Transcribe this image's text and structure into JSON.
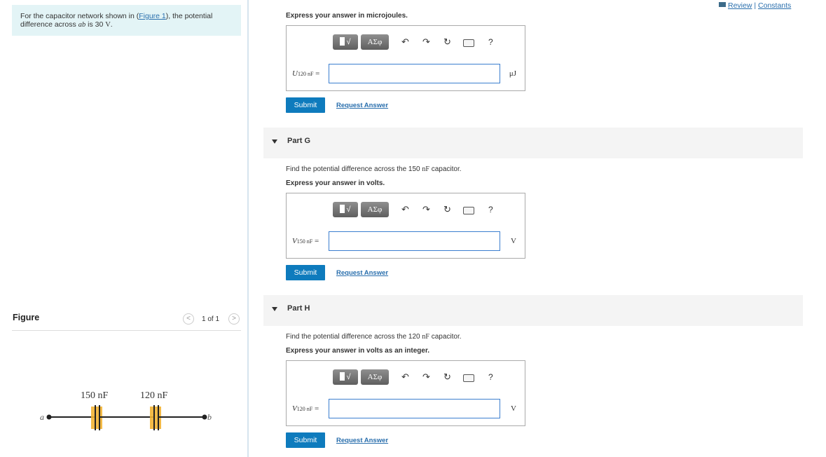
{
  "header": {
    "review_label": "Review",
    "sep": "|",
    "constants_label": "Constants"
  },
  "problem": {
    "text_pre": "For the capacitor network shown in (",
    "figure_link": "Figure 1",
    "text_mid": "), the potential difference across ",
    "var": "ab",
    "text_post": " is 30 ",
    "unit": "V",
    "end": "."
  },
  "figure": {
    "title": "Figure",
    "pager": "1 of 1",
    "prev": "<",
    "next": ">",
    "cap1_label": "150 nF",
    "cap2_label": "120 nF",
    "node_a": "a",
    "node_b": "b"
  },
  "toolbar": {
    "templates_label": "√",
    "greek_label": "ΑΣφ",
    "help_label": "?"
  },
  "sections": {
    "top": {
      "express": "Express your answer in microjoules.",
      "var_main": "U",
      "var_sub": "120 nF",
      "equals": "=",
      "input_value": "",
      "unit": "μJ",
      "submit": "Submit",
      "request": "Request Answer"
    },
    "partG": {
      "title": "Part G",
      "find_pre": "Find the potential difference across the 150 ",
      "find_unit": "nF",
      "find_post": " capacitor.",
      "express": "Express your answer in volts.",
      "var_main": "V",
      "var_sub": "150 nF",
      "equals": "=",
      "input_value": "",
      "unit": "V",
      "submit": "Submit",
      "request": "Request Answer"
    },
    "partH": {
      "title": "Part H",
      "find_pre": "Find the potential difference across the 120 ",
      "find_unit": "nF",
      "find_post": " capacitor.",
      "express": "Express your answer in volts as an integer.",
      "var_main": "V",
      "var_sub": "120 nF",
      "equals": "=",
      "input_value": "",
      "unit": "V",
      "submit": "Submit",
      "request": "Request Answer"
    }
  },
  "colors": {
    "accent": "#0e7bbd",
    "link": "#2a6fad",
    "problem_bg": "#e3f4f6",
    "capacitor_fill": "#f2b233"
  }
}
